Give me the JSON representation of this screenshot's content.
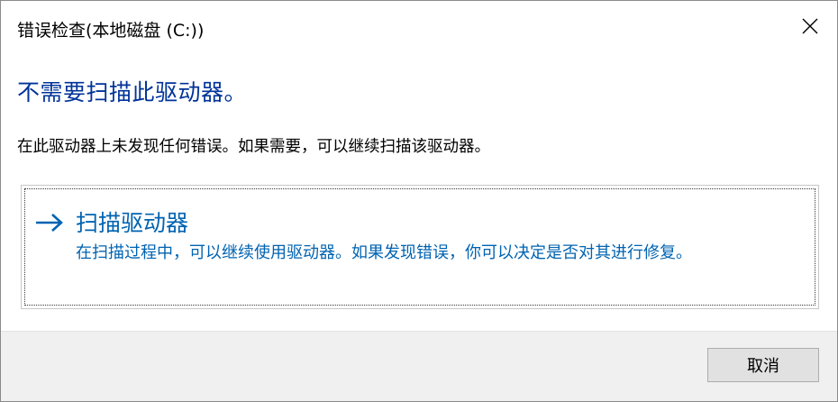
{
  "window": {
    "title": "错误检查(本地磁盘 (C:))"
  },
  "header": {
    "heading": "不需要扫描此驱动器。",
    "message": "在此驱动器上未发现任何错误。如果需要，可以继续扫描该驱动器。"
  },
  "scan_option": {
    "icon": "arrow-right-icon",
    "title": "扫描驱动器",
    "description": "在扫描过程中，可以继续使用驱动器。如果发现错误，你可以决定是否对其进行修复。"
  },
  "footer": {
    "cancel_label": "取消"
  },
  "colors": {
    "heading": "#003399",
    "link": "#0063b1",
    "footer_bg": "#f0f0f0",
    "button_bg": "#e1e1e1"
  }
}
